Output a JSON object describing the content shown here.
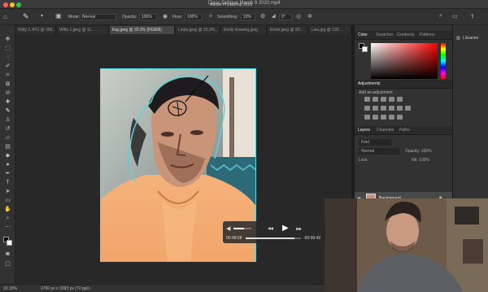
{
  "window": {
    "title": "Class Critique March 9 2020.mp4",
    "app_title": "Adobe Photoshop 2020",
    "traffic_colors": [
      "#fe5f57",
      "#febc2e",
      "#28c840"
    ]
  },
  "options": {
    "mode_label": "Mode:",
    "mode_value": "Normal",
    "opacity_label": "Opacity:",
    "opacity_value": "100%",
    "flow_label": "Flow:",
    "flow_value": "100%",
    "smoothing_label": "Smoothing:",
    "smoothing_value": "10%",
    "angle_value": "0°"
  },
  "tabs": [
    {
      "label": "Wilfy 2.JPG @ 300...",
      "active": false
    },
    {
      "label": "Wilfo 1.jpeg @ 11...",
      "active": false
    },
    {
      "label": "Kay.jpeg @ 33.3% (RGB/8)",
      "active": true
    },
    {
      "label": "Linda.jpeg @ 33.3%...",
      "active": false
    },
    {
      "label": "Emily drawing.jpeg",
      "active": false
    },
    {
      "label": "Emils.jpeg @ 33...",
      "active": false
    },
    {
      "label": "Lisa.jpg @ 133...",
      "active": false
    }
  ],
  "status": {
    "zoom": "33.33%",
    "doc_info": "2700 px x 3393 px (72 ppi)"
  },
  "panels": {
    "color_tabs": [
      "Color",
      "Swatches",
      "Gradients",
      "Patterns"
    ],
    "adjustments_title": "Adjustments",
    "adjustments_hint": "Add an adjustment",
    "layers_tabs": [
      "Layers",
      "Channels",
      "Paths"
    ],
    "layer_kind": "Kind",
    "layer_blend": "Normal",
    "layer_opacity": "Opacity: 100%",
    "layer_lock": "Lock:",
    "layer_fill": "Fill: 100%",
    "layer_name": "Background",
    "libraries_label": "Libraries",
    "accent_color": "#50d8e0"
  },
  "player": {
    "elapsed": "00:48:58",
    "remaining": "-00:06:42",
    "progress": 0.88,
    "volume": 0.6
  }
}
